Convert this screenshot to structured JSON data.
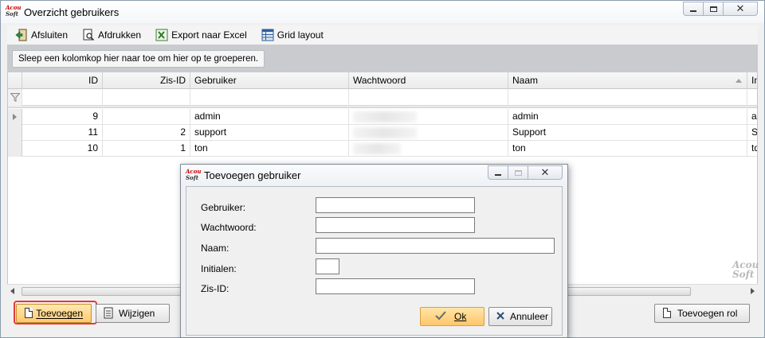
{
  "window": {
    "title": "Overzicht gebruikers",
    "logo_text": [
      "Acou",
      "Soft"
    ],
    "controls": [
      "minimize",
      "restore",
      "close"
    ]
  },
  "toolbar": {
    "items": [
      {
        "label": "Afsluiten",
        "icon": "exit-door-icon"
      },
      {
        "label": "Afdrukken",
        "icon": "print-preview-icon"
      },
      {
        "label": "Export naar Excel",
        "icon": "excel-icon"
      },
      {
        "label": "Grid layout",
        "icon": "grid-layout-icon"
      }
    ]
  },
  "group_panel": {
    "hint": "Sleep een kolomkop hier naar toe om hier op te groeperen."
  },
  "grid": {
    "columns": [
      "ID",
      "Zis-ID",
      "Gebruiker",
      "Wachtwoord",
      "Naam",
      "In"
    ],
    "sorted_column": "Naam",
    "rows": [
      {
        "id": "9",
        "zis_id": "",
        "gebruiker": "admin",
        "wachtwoord": "",
        "naam": "admin",
        "initialen": "ad"
      },
      {
        "id": "11",
        "zis_id": "2",
        "gebruiker": "support",
        "wachtwoord": "",
        "naam": "Support",
        "initialen": "SD"
      },
      {
        "id": "10",
        "zis_id": "1",
        "gebruiker": "ton",
        "wachtwoord": "",
        "naam": "ton",
        "initialen": "td"
      }
    ]
  },
  "watermark": [
    "Acou",
    "Soft"
  ],
  "bottom_buttons": {
    "add": "Toevoegen",
    "edit": "Wijzigen",
    "add_role": "Toevoegen rol"
  },
  "dialog": {
    "title": "Toevoegen gebruiker",
    "logo_text": [
      "Acou",
      "Soft"
    ],
    "fields": {
      "gebruiker": {
        "label": "Gebruiker:",
        "value": ""
      },
      "wachtwoord": {
        "label": "Wachtwoord:",
        "value": ""
      },
      "naam": {
        "label": "Naam:",
        "value": ""
      },
      "initialen": {
        "label": "Initialen:",
        "value": ""
      },
      "zis_id": {
        "label": "Zis-ID:",
        "value": ""
      }
    },
    "ok_label": "Ok",
    "cancel_label": "Annuleer"
  },
  "colors": {
    "highlight": "#e53935",
    "primary_button": "#ffc970",
    "group_panel": "#c9cbcf"
  }
}
